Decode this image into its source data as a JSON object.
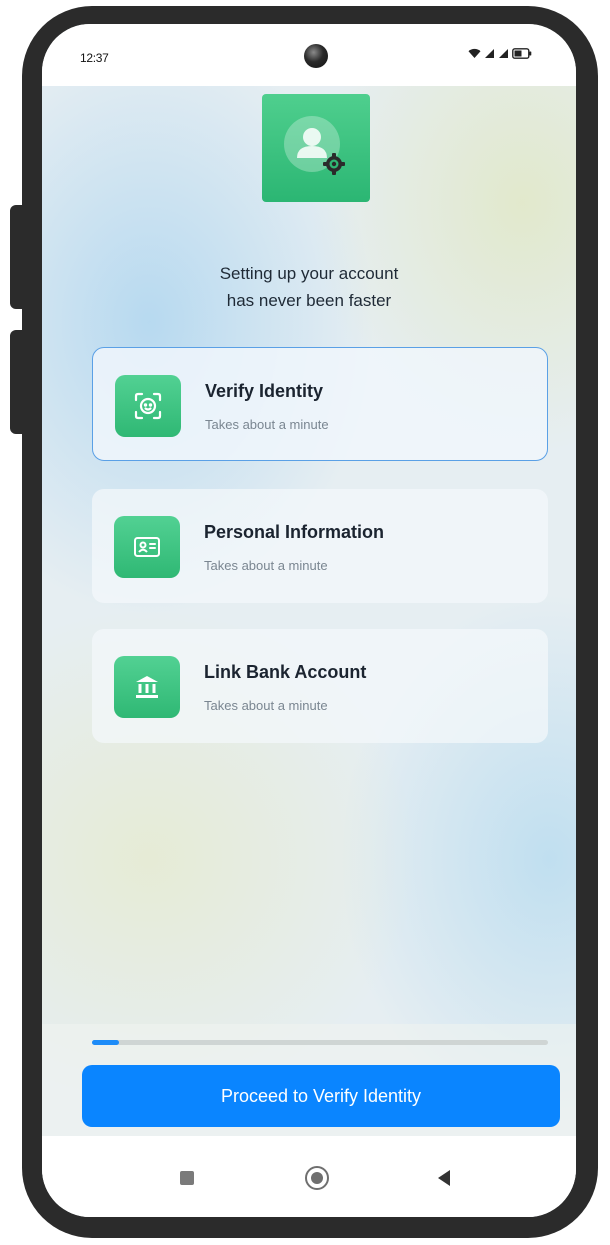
{
  "status_bar": {
    "time": "12:37"
  },
  "headline": {
    "line1": "Setting up your account",
    "line2": "has never been faster"
  },
  "steps": [
    {
      "title": "Verify Identity",
      "subtitle": "Takes about a minute",
      "icon": "face-scan-icon",
      "active": true
    },
    {
      "title": "Personal Information",
      "subtitle": "Takes about a minute",
      "icon": "id-card-icon",
      "active": false
    },
    {
      "title": "Link Bank Account",
      "subtitle": "Takes about a minute",
      "icon": "bank-icon",
      "active": false
    }
  ],
  "progress": {
    "fraction": 0.06
  },
  "primary_button": {
    "label": "Proceed to Verify Identity"
  },
  "colors": {
    "accent": "#0a85ff",
    "brand_green": "#2fb874",
    "active_border": "#5aa0e6"
  },
  "nav": {
    "items": [
      "recents-square-icon",
      "home-circle-icon",
      "back-triangle-icon"
    ]
  }
}
